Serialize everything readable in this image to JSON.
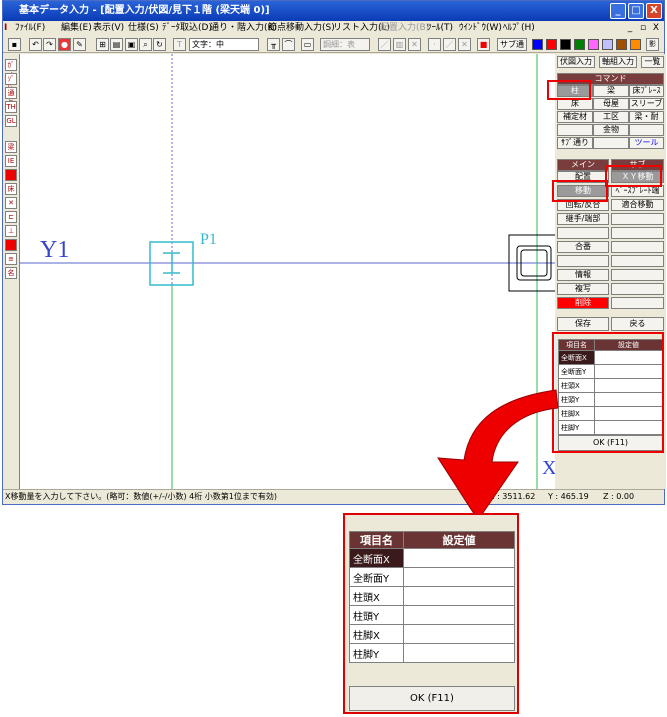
{
  "window": {
    "title": "基本データ入力 - [配置入力/伏図/見下１階 (梁天端 0)]",
    "min": "_",
    "max": "□",
    "close": "X",
    "mdi_min": "_",
    "mdi_restore": "▫",
    "mdi_close": "X"
  },
  "menu": [
    "ﾌｧｲﾙ(F)",
    "編集(E)",
    "表示(V)",
    "仕様(S)",
    "ﾃﾞｰﾀ取込(D)",
    "通り・階入力(K)",
    "節点移動入力(S)",
    "リスト入力(L)",
    "配置入力(B)",
    "ﾂｰﾙ(T)",
    "ｳｲﾝﾄﾞｳ(W)",
    "ﾍﾙﾌﾟ(H)"
  ],
  "toolbar": {
    "text_size_label": "文字：中",
    "select_label": "鋼細：表",
    "sub_label": "サブ通"
  },
  "colors": {
    "swatches": [
      "#0000ff",
      "#ff0000",
      "#000000",
      "#008000",
      "#ff66ff",
      "#c0c0ff",
      "#a05000",
      "#ff8c00"
    ]
  },
  "lefttb": [
    "ｶﾞｲﾄﾞ",
    "ｿﾞｰﾝ",
    "通り",
    "TH",
    "GL",
    "梁",
    "IE",
    "",
    "床",
    "",
    "",
    "",
    "",
    "",
    "名"
  ],
  "canvas": {
    "label_y1": "Y1",
    "label_p1": "P1",
    "label_x": "X"
  },
  "rpanel": {
    "top_buttons": [
      "伏図入力",
      "軸組入力",
      "一覧"
    ],
    "command_header": "コマンド",
    "commands": [
      "柱",
      "梁",
      "床ﾌﾞﾚｰｽ",
      "床",
      "母屋",
      "スリーブ",
      "補定材",
      "工区",
      "梁・耐",
      "",
      "金物",
      "",
      "ｻﾌﾞ通り",
      "",
      "ツール"
    ],
    "main_header": "メイン",
    "sub_header": "サブ",
    "main_items": [
      "配置",
      "移動",
      "回転/反合",
      "継手/端部",
      "",
      "合番",
      "",
      "情報",
      "複写",
      "削除"
    ],
    "sub_items": [
      "ＸＹ移動",
      "ﾍﾞｰｽﾌﾟﾚｰﾄ端",
      "適合移動",
      "",
      "",
      "",
      "",
      "",
      "",
      ""
    ],
    "save": "保存",
    "back": "戻る",
    "grid_headers": [
      "項目名",
      "設定値"
    ],
    "grid_rows": [
      "全断面X",
      "全断面Y",
      "柱頭X",
      "柱頭Y",
      "柱脚X",
      "柱脚Y"
    ],
    "ok": "OK (F11)"
  },
  "status": {
    "message": "X移動量を入力して下さい。(略可：数値(+/-/小数) 4桁 小数第1位まで有効)",
    "x": "X : 3511.62",
    "y": "Y : 465.19",
    "z": "Z : 0.00"
  },
  "zoom": {
    "headers": [
      "項目名",
      "設定値"
    ],
    "rows": [
      "全断面X",
      "全断面Y",
      "柱頭X",
      "柱頭Y",
      "柱脚X",
      "柱脚Y"
    ],
    "ok": "OK (F11)"
  }
}
